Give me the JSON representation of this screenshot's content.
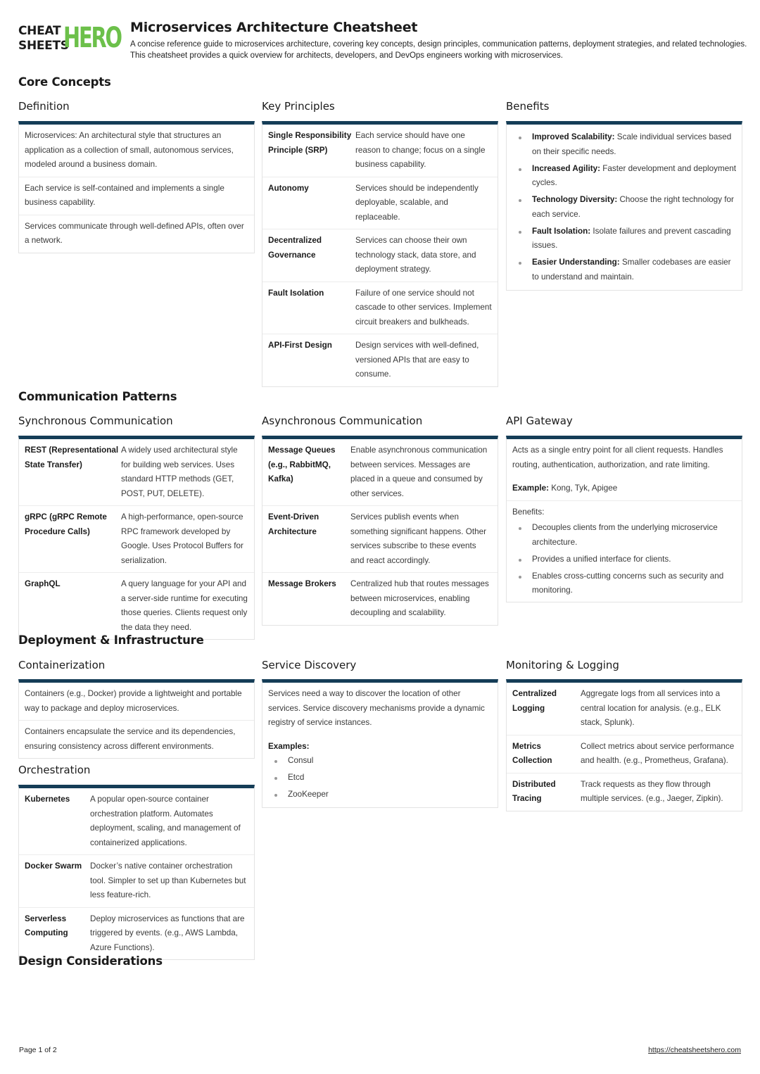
{
  "logo": {
    "top": "CHEAT",
    "bottom": "SHEETS",
    "hero": "HERO"
  },
  "header": {
    "title": "Microservices Architecture Cheatsheet",
    "subtitle": "A concise reference guide to microservices architecture, covering key concepts, design principles, communication patterns, deployment strategies, and related technologies. This cheatsheet provides a quick overview for architects, developers, and DevOps engineers working with microservices."
  },
  "sections": {
    "core": "Core Concepts",
    "comm": "Communication Patterns",
    "deploy": "Deployment & Infrastructure",
    "design": "Design Considerations"
  },
  "definition": {
    "title": "Definition",
    "rows": [
      "Microservices: An architectural style that structures an application as a collection of small, autonomous services, modeled around a business domain.",
      "Each service is self-contained and implements a single business capability.",
      "Services communicate through well-defined APIs, often over a network."
    ]
  },
  "principles": {
    "title": "Key Principles",
    "rows": [
      {
        "k": "Single Responsibility Principle (SRP)",
        "v": "Each service should have one reason to change; focus on a single business capability."
      },
      {
        "k": "Autonomy",
        "v": "Services should be independently deployable, scalable, and replaceable."
      },
      {
        "k": "Decentralized Governance",
        "v": "Services can choose their own technology stack, data store, and deployment strategy."
      },
      {
        "k": "Fault Isolation",
        "v": "Failure of one service should not cascade to other services. Implement circuit breakers and bulkheads."
      },
      {
        "k": "API-First Design",
        "v": "Design services with well-defined, versioned APIs that are easy to consume."
      }
    ]
  },
  "benefits": {
    "title": "Benefits",
    "items": [
      {
        "b": "Improved Scalability:",
        "t": " Scale individual services based on their specific needs."
      },
      {
        "b": "Increased Agility:",
        "t": " Faster development and deployment cycles."
      },
      {
        "b": "Technology Diversity:",
        "t": " Choose the right technology for each service."
      },
      {
        "b": "Fault Isolation:",
        "t": " Isolate failures and prevent cascading issues."
      },
      {
        "b": "Easier Understanding:",
        "t": " Smaller codebases are easier to understand and maintain."
      }
    ]
  },
  "sync": {
    "title": "Synchronous Communication",
    "rows": [
      {
        "k": "REST (Representational State Transfer)",
        "v": "A widely used architectural style for building web services. Uses standard HTTP methods (GET, POST, PUT, DELETE)."
      },
      {
        "k": "gRPC (gRPC Remote Procedure Calls)",
        "v": "A high-performance, open-source RPC framework developed by Google. Uses Protocol Buffers for serialization."
      },
      {
        "k": "GraphQL",
        "v": "A query language for your API and a server-side runtime for executing those queries. Clients request only the data they need."
      }
    ]
  },
  "async": {
    "title": "Asynchronous Communication",
    "rows": [
      {
        "k": "Message Queues (e.g., RabbitMQ, Kafka)",
        "v": "Enable asynchronous communication between services. Messages are placed in a queue and consumed by other services."
      },
      {
        "k": "Event-Driven Architecture",
        "v": "Services publish events when something significant happens. Other services subscribe to these events and react accordingly."
      },
      {
        "k": "Message Brokers",
        "v": "Centralized hub that routes messages between microservices, enabling decoupling and scalability."
      }
    ]
  },
  "gateway": {
    "title": "API Gateway",
    "desc": "Acts as a single entry point for all client requests. Handles routing, authentication, authorization, and rate limiting.",
    "example_label": "Example:",
    "example": " Kong, Tyk, Apigee",
    "benefits_label": "Benefits:",
    "benefits": [
      "Decouples clients from the underlying microservice architecture.",
      "Provides a unified interface for clients.",
      "Enables cross-cutting concerns such as security and monitoring."
    ]
  },
  "container": {
    "title": "Containerization",
    "rows": [
      "Containers (e.g., Docker) provide a lightweight and portable way to package and deploy microservices.",
      "Containers encapsulate the service and its dependencies, ensuring consistency across different environments."
    ]
  },
  "orchestration": {
    "title": "Orchestration",
    "rows": [
      {
        "k": "Kubernetes",
        "v": "A popular open-source container orchestration platform. Automates deployment, scaling, and management of containerized applications."
      },
      {
        "k": "Docker Swarm",
        "v": "Docker’s native container orchestration tool. Simpler to set up than Kubernetes but less feature-rich."
      },
      {
        "k": "Serverless Computing",
        "v": "Deploy microservices as functions that are triggered by events. (e.g., AWS Lambda, Azure Functions)."
      }
    ]
  },
  "discovery": {
    "title": "Service Discovery",
    "desc": "Services need a way to discover the location of other services. Service discovery mechanisms provide a dynamic registry of service instances.",
    "examples_label": "Examples:",
    "examples": [
      "Consul",
      "Etcd",
      "ZooKeeper"
    ]
  },
  "monitoring": {
    "title": "Monitoring & Logging",
    "rows": [
      {
        "k": "Centralized Logging",
        "v": "Aggregate logs from all services into a central location for analysis. (e.g., ELK stack, Splunk)."
      },
      {
        "k": "Metrics Collection",
        "v": "Collect metrics about service performance and health. (e.g., Prometheus, Grafana)."
      },
      {
        "k": "Distributed Tracing",
        "v": "Track requests as they flow through multiple services. (e.g., Jaeger, Zipkin)."
      }
    ]
  },
  "footer": {
    "page": "Page 1 of 2",
    "url": "https://cheatsheetshero.com"
  }
}
